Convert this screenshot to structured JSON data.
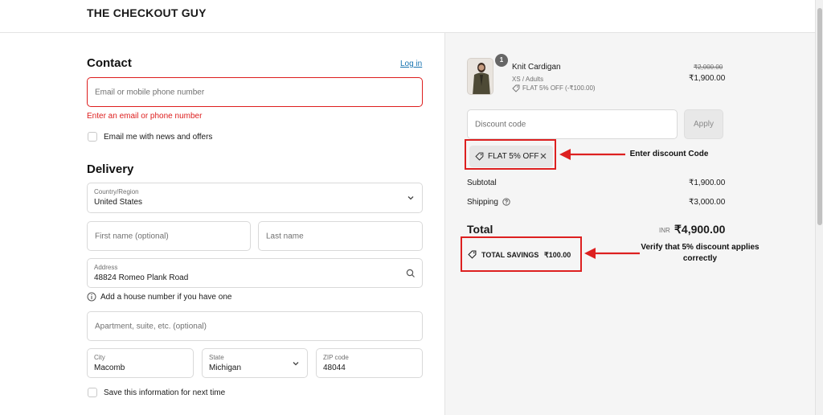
{
  "header": {
    "brand": "THE CHECKOUT GUY"
  },
  "contact": {
    "title": "Contact",
    "login_link": "Log in",
    "email_placeholder": "Email or mobile phone number",
    "error": "Enter an email or phone number",
    "news_label": "Email me with news and offers"
  },
  "delivery": {
    "title": "Delivery",
    "country_label": "Country/Region",
    "country_value": "United States",
    "first_name_placeholder": "First name (optional)",
    "last_name_placeholder": "Last name",
    "address_label": "Address",
    "address_value": "48824 Romeo Plank Road",
    "address_hint": "Add a house number if you have one",
    "apt_placeholder": "Apartment, suite, etc. (optional)",
    "city_label": "City",
    "city_value": "Macomb",
    "state_label": "State",
    "state_value": "Michigan",
    "zip_label": "ZIP code",
    "zip_value": "48044",
    "save_label": "Save this information for next time"
  },
  "summary": {
    "item": {
      "quantity": "1",
      "name": "Knit Cardigan",
      "variant": "XS / Adults",
      "discount": "FLAT 5% OFF (-₹100.00)",
      "original_price": "₹2,000.00",
      "price": "₹1,900.00"
    },
    "discount_placeholder": "Discount code",
    "apply_label": "Apply",
    "applied_code": "FLAT 5% OFF",
    "subtotal_label": "Subtotal",
    "subtotal_value": "₹1,900.00",
    "shipping_label": "Shipping",
    "shipping_value": "₹3,000.00",
    "total_label": "Total",
    "currency": "INR",
    "total_value": "₹4,900.00",
    "savings_label": "TOTAL SAVINGS",
    "savings_value": "₹100.00"
  },
  "annotations": {
    "enter_code": "Enter discount Code",
    "verify": "Verify that 5% discount applies correctly"
  },
  "colors": {
    "annotation_red": "#dd2020",
    "error_red": "#dd1d1d",
    "link_blue": "#1773b0"
  }
}
